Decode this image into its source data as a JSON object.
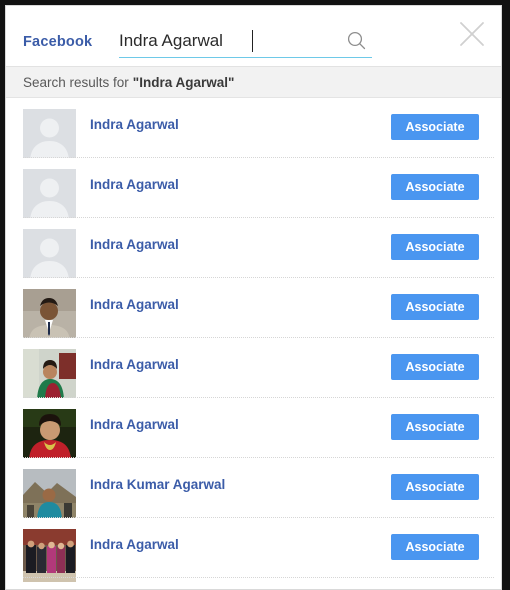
{
  "window": {
    "brand": "Facebook",
    "close_label": "close-icon"
  },
  "search": {
    "value": "Indra Agarwal",
    "placeholder": "Search",
    "icon": "search-icon"
  },
  "banner": {
    "prefix": "Search results for",
    "query": "\"Indra Agarwal\""
  },
  "colors": {
    "brand_blue": "#3b5ca8",
    "button_blue": "#4a96f0",
    "underline_blue": "#6ec9e8",
    "banner_bg": "#f2f2f2",
    "avatar_placeholder": "#dcdfe3"
  },
  "results": [
    {
      "name": "Indra Agarwal",
      "action": "Associate",
      "avatar": "placeholder"
    },
    {
      "name": "Indra Agarwal",
      "action": "Associate",
      "avatar": "placeholder"
    },
    {
      "name": "Indra Agarwal",
      "action": "Associate",
      "avatar": "placeholder"
    },
    {
      "name": "Indra Agarwal",
      "action": "Associate",
      "avatar": "photo-man-suit"
    },
    {
      "name": "Indra Agarwal",
      "action": "Associate",
      "avatar": "photo-woman-green-saree"
    },
    {
      "name": "Indra Agarwal",
      "action": "Associate",
      "avatar": "photo-woman-red"
    },
    {
      "name": "Indra Kumar Agarwal",
      "action": "Associate",
      "avatar": "photo-man-outdoors"
    },
    {
      "name": "Indra Agarwal",
      "action": "Associate",
      "avatar": "photo-group"
    }
  ]
}
